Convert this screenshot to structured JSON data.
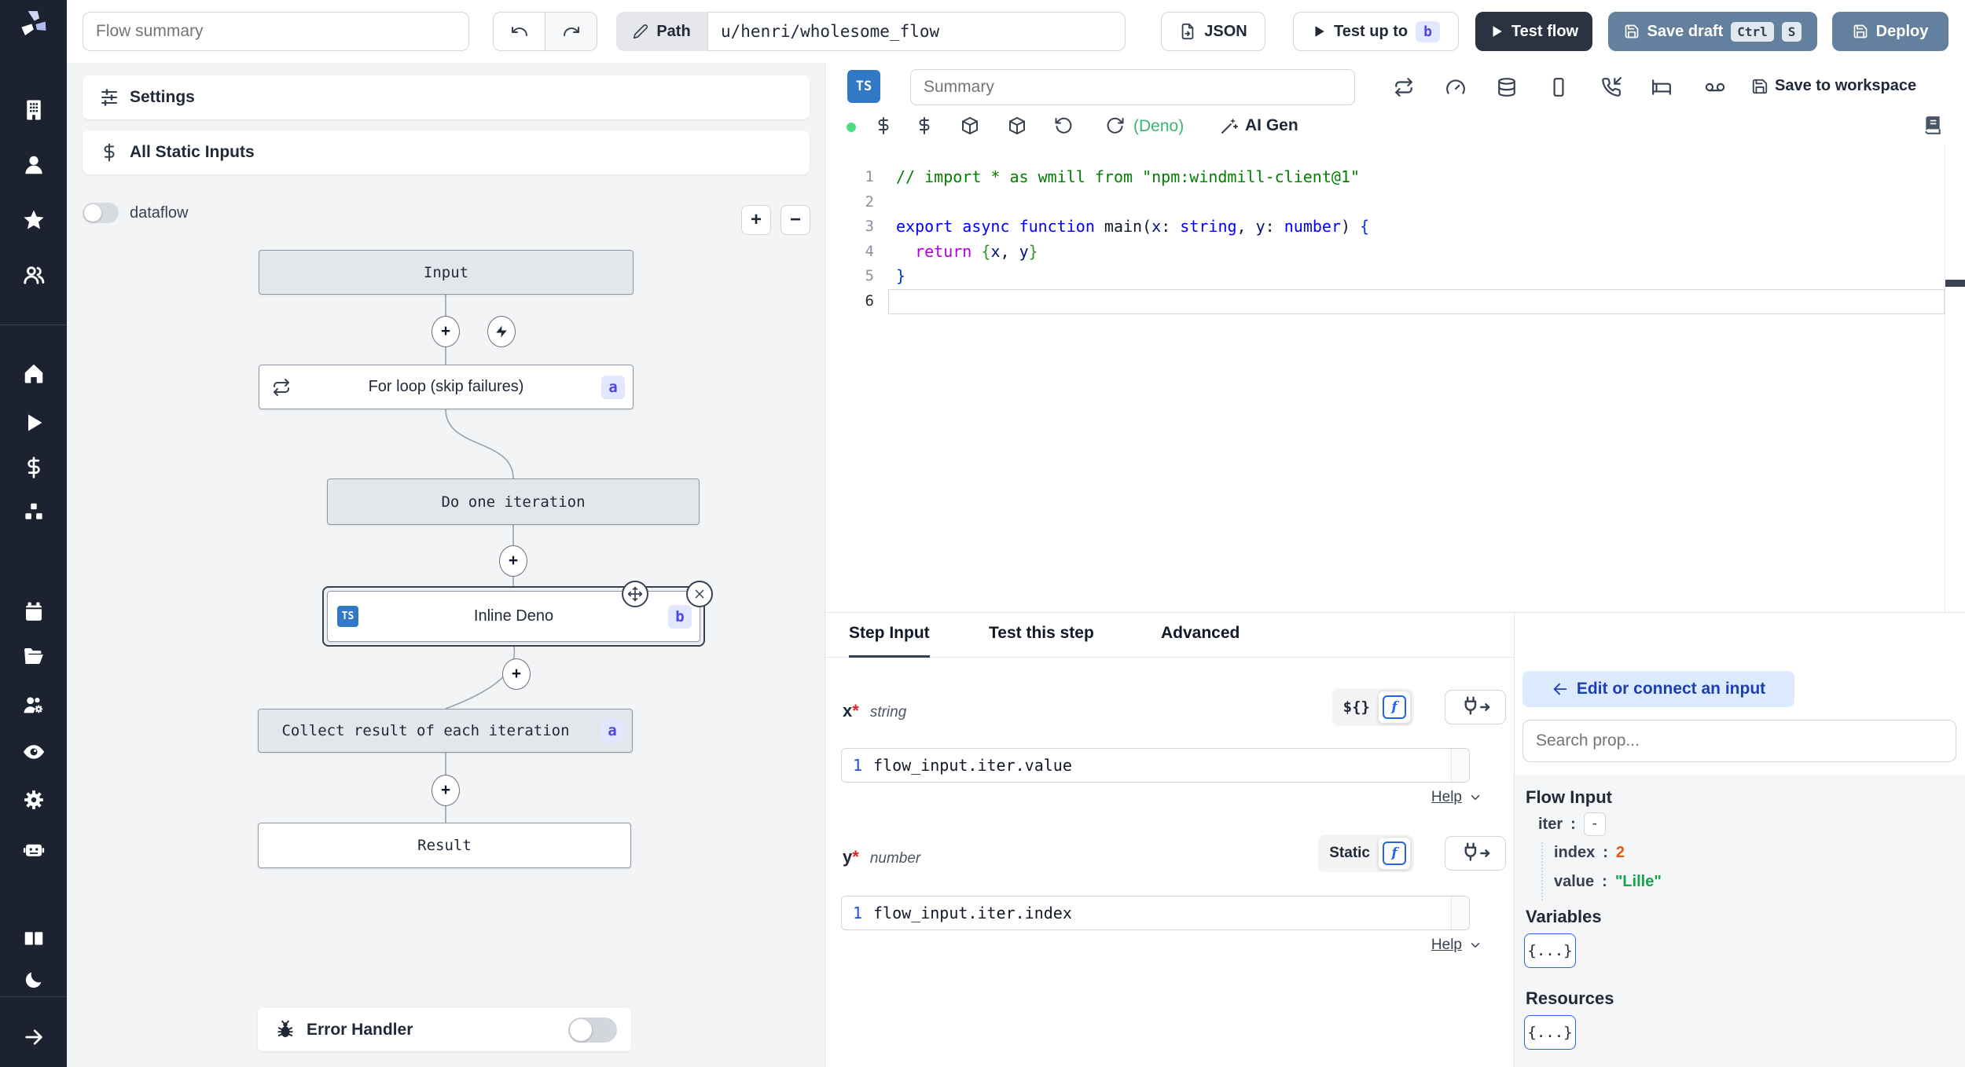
{
  "topbar": {
    "flow_summary_placeholder": "Flow summary",
    "path_label": "Path",
    "path_value": "u/henri/wholesome_flow",
    "json_label": "JSON",
    "test_up_to_label": "Test up to",
    "test_up_to_badge": "b",
    "test_flow_label": "Test flow",
    "save_draft_label": "Save draft",
    "save_draft_kbd1": "Ctrl",
    "save_draft_kbd2": "S",
    "deploy_label": "Deploy"
  },
  "sidebar": {
    "icon_names": [
      "windmill-logo",
      "workspace-building",
      "user",
      "favorites-star",
      "groups-users",
      "home",
      "runs-play",
      "variables-dollar",
      "resources-boxes",
      "schedules-calendar",
      "folders-folder",
      "groups-cog",
      "audit-logs-eye",
      "settings-gear",
      "ai-robot",
      "docs-books",
      "dark-mode-moon",
      "collapse-sidebar-arrow"
    ]
  },
  "flow_panel": {
    "settings_label": "Settings",
    "static_inputs_label": "All Static Inputs",
    "dataflow_label": "dataflow",
    "zoom_in_label": "+",
    "zoom_out_label": "−",
    "error_handler_label": "Error Handler"
  },
  "graph": {
    "input_label": "Input",
    "forloop_label": "For loop (skip failures)",
    "forloop_badge": "a",
    "iteration_label": "Do one iteration",
    "deno_lang": "TS",
    "deno_label": "Inline Deno",
    "deno_badge": "b",
    "collect_label": "Collect result of each iteration",
    "collect_badge": "a",
    "result_label": "Result"
  },
  "editor": {
    "lang_badge": "TS",
    "summary_placeholder": "Summary",
    "toolbar_icons": [
      "repeat",
      "gauge",
      "database",
      "smartphone",
      "phone-incoming",
      "bed",
      "voicemail"
    ],
    "save_to_workspace_label": "Save to workspace",
    "lang_toolbar_icons": [
      "status-dot",
      "dollar",
      "dollar",
      "package",
      "package",
      "rotate-ccw",
      "refresh"
    ],
    "deno_runtime_label": "(Deno)",
    "ai_gen_label": "AI Gen",
    "book_icon": "book",
    "active_line": 6,
    "code_lines": [
      {
        "tokens": [
          {
            "t": "// import * as wmill from \"npm:windmill-client@1\"",
            "c": "cm"
          }
        ]
      },
      {
        "tokens": []
      },
      {
        "tokens": [
          {
            "t": "export",
            "c": "kw"
          },
          {
            "t": " ",
            "c": "pl"
          },
          {
            "t": "async",
            "c": "kw"
          },
          {
            "t": " ",
            "c": "pl"
          },
          {
            "t": "function",
            "c": "kw"
          },
          {
            "t": " main(",
            "c": "pl"
          },
          {
            "t": "x",
            "c": "id"
          },
          {
            "t": ": ",
            "c": "pl"
          },
          {
            "t": "string",
            "c": "ty"
          },
          {
            "t": ", ",
            "c": "pl"
          },
          {
            "t": "y",
            "c": "id"
          },
          {
            "t": ": ",
            "c": "pl"
          },
          {
            "t": "number",
            "c": "ty"
          },
          {
            "t": ") ",
            "c": "pl"
          },
          {
            "t": "{",
            "c": "b1"
          }
        ]
      },
      {
        "tokens": [
          {
            "t": "  ",
            "c": "pl"
          },
          {
            "t": "return",
            "c": "ctl"
          },
          {
            "t": " ",
            "c": "pl"
          },
          {
            "t": "{",
            "c": "b2"
          },
          {
            "t": "x",
            "c": "id"
          },
          {
            "t": ", ",
            "c": "pl"
          },
          {
            "t": "y",
            "c": "id"
          },
          {
            "t": "}",
            "c": "b2"
          }
        ]
      },
      {
        "tokens": [
          {
            "t": "}",
            "c": "b1"
          }
        ]
      },
      {
        "tokens": []
      }
    ]
  },
  "step_panel": {
    "tabs": [
      "Step Input",
      "Test this step",
      "Advanced"
    ],
    "help_label": "Help",
    "fields": [
      {
        "name": "x",
        "required_mark": "*",
        "type": "string",
        "mode_label": "${}",
        "fn_icon": "f",
        "code_line_number": "1",
        "code": "flow_input.iter.value"
      },
      {
        "name": "y",
        "required_mark": "*",
        "type": "number",
        "mode_label": "Static",
        "fn_icon": "f",
        "code_line_number": "1",
        "code": "flow_input.iter.index"
      }
    ]
  },
  "connect_panel": {
    "edit_button_label": "Edit or connect an input",
    "search_placeholder": "Search prop...",
    "flow_input_title": "Flow Input",
    "colon": ":",
    "iter_key": "iter",
    "iter_value": "-",
    "index_key": "index",
    "index_value": "2",
    "value_key": "value",
    "value_value": "\"Lille\"",
    "variables_title": "Variables",
    "resources_title": "Resources",
    "object_button_label": "{...}"
  },
  "colors": {
    "accent_blue": "#64809f",
    "dark_button": "#2b3343",
    "badge_bg": "#e0e7ff",
    "badge_text": "#4f46e5",
    "ts_blue": "#3178c6",
    "deno_green": "#3cb371",
    "json_number_orange": "#ea580c",
    "json_string_green": "#16a34a",
    "sidebar_bg": "#1c2230"
  }
}
